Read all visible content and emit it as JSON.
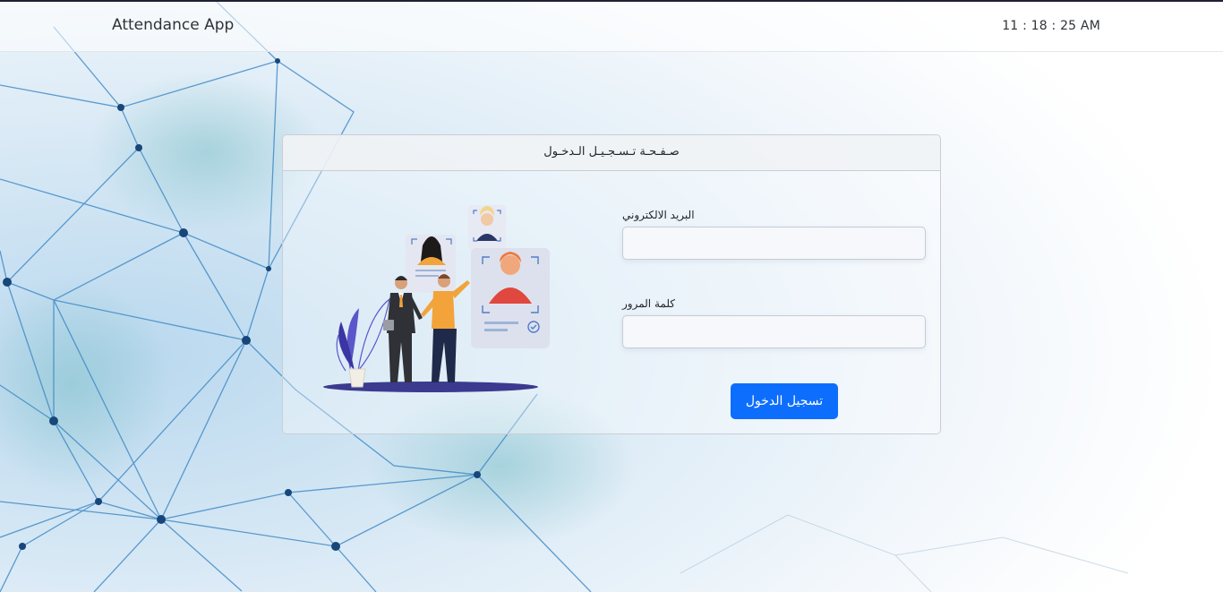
{
  "navbar": {
    "brand": "Attendance App",
    "clock": "11 : 18 : 25 AM"
  },
  "login_card": {
    "title": "صـفـحـة تـسـجـيـل الـدخـول",
    "email_label": "البريد الالكتروني",
    "email_value": "",
    "password_label": "كلمة المرور",
    "password_value": "",
    "submit_label": "تسجيل الدخول"
  },
  "colors": {
    "primary_button": "#0d6efd",
    "top_border": "#1f2033",
    "network_line": "#3a86c4",
    "network_node": "#17467a"
  },
  "icons": [
    "network-background",
    "team-illustration"
  ]
}
